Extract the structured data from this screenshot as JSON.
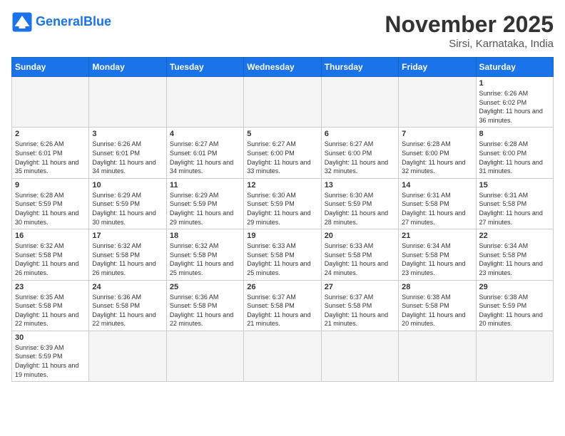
{
  "header": {
    "logo_general": "General",
    "logo_blue": "Blue",
    "month_title": "November 2025",
    "location": "Sirsi, Karnataka, India"
  },
  "days_of_week": [
    "Sunday",
    "Monday",
    "Tuesday",
    "Wednesday",
    "Thursday",
    "Friday",
    "Saturday"
  ],
  "weeks": [
    [
      {
        "day": "",
        "info": ""
      },
      {
        "day": "",
        "info": ""
      },
      {
        "day": "",
        "info": ""
      },
      {
        "day": "",
        "info": ""
      },
      {
        "day": "",
        "info": ""
      },
      {
        "day": "",
        "info": ""
      },
      {
        "day": "1",
        "info": "Sunrise: 6:26 AM\nSunset: 6:02 PM\nDaylight: 11 hours and 36 minutes."
      }
    ],
    [
      {
        "day": "2",
        "info": "Sunrise: 6:26 AM\nSunset: 6:01 PM\nDaylight: 11 hours and 35 minutes."
      },
      {
        "day": "3",
        "info": "Sunrise: 6:26 AM\nSunset: 6:01 PM\nDaylight: 11 hours and 34 minutes."
      },
      {
        "day": "4",
        "info": "Sunrise: 6:27 AM\nSunset: 6:01 PM\nDaylight: 11 hours and 34 minutes."
      },
      {
        "day": "5",
        "info": "Sunrise: 6:27 AM\nSunset: 6:00 PM\nDaylight: 11 hours and 33 minutes."
      },
      {
        "day": "6",
        "info": "Sunrise: 6:27 AM\nSunset: 6:00 PM\nDaylight: 11 hours and 32 minutes."
      },
      {
        "day": "7",
        "info": "Sunrise: 6:28 AM\nSunset: 6:00 PM\nDaylight: 11 hours and 32 minutes."
      },
      {
        "day": "8",
        "info": "Sunrise: 6:28 AM\nSunset: 6:00 PM\nDaylight: 11 hours and 31 minutes."
      }
    ],
    [
      {
        "day": "9",
        "info": "Sunrise: 6:28 AM\nSunset: 5:59 PM\nDaylight: 11 hours and 30 minutes."
      },
      {
        "day": "10",
        "info": "Sunrise: 6:29 AM\nSunset: 5:59 PM\nDaylight: 11 hours and 30 minutes."
      },
      {
        "day": "11",
        "info": "Sunrise: 6:29 AM\nSunset: 5:59 PM\nDaylight: 11 hours and 29 minutes."
      },
      {
        "day": "12",
        "info": "Sunrise: 6:30 AM\nSunset: 5:59 PM\nDaylight: 11 hours and 29 minutes."
      },
      {
        "day": "13",
        "info": "Sunrise: 6:30 AM\nSunset: 5:59 PM\nDaylight: 11 hours and 28 minutes."
      },
      {
        "day": "14",
        "info": "Sunrise: 6:31 AM\nSunset: 5:58 PM\nDaylight: 11 hours and 27 minutes."
      },
      {
        "day": "15",
        "info": "Sunrise: 6:31 AM\nSunset: 5:58 PM\nDaylight: 11 hours and 27 minutes."
      }
    ],
    [
      {
        "day": "16",
        "info": "Sunrise: 6:32 AM\nSunset: 5:58 PM\nDaylight: 11 hours and 26 minutes."
      },
      {
        "day": "17",
        "info": "Sunrise: 6:32 AM\nSunset: 5:58 PM\nDaylight: 11 hours and 26 minutes."
      },
      {
        "day": "18",
        "info": "Sunrise: 6:32 AM\nSunset: 5:58 PM\nDaylight: 11 hours and 25 minutes."
      },
      {
        "day": "19",
        "info": "Sunrise: 6:33 AM\nSunset: 5:58 PM\nDaylight: 11 hours and 25 minutes."
      },
      {
        "day": "20",
        "info": "Sunrise: 6:33 AM\nSunset: 5:58 PM\nDaylight: 11 hours and 24 minutes."
      },
      {
        "day": "21",
        "info": "Sunrise: 6:34 AM\nSunset: 5:58 PM\nDaylight: 11 hours and 23 minutes."
      },
      {
        "day": "22",
        "info": "Sunrise: 6:34 AM\nSunset: 5:58 PM\nDaylight: 11 hours and 23 minutes."
      }
    ],
    [
      {
        "day": "23",
        "info": "Sunrise: 6:35 AM\nSunset: 5:58 PM\nDaylight: 11 hours and 22 minutes."
      },
      {
        "day": "24",
        "info": "Sunrise: 6:36 AM\nSunset: 5:58 PM\nDaylight: 11 hours and 22 minutes."
      },
      {
        "day": "25",
        "info": "Sunrise: 6:36 AM\nSunset: 5:58 PM\nDaylight: 11 hours and 22 minutes."
      },
      {
        "day": "26",
        "info": "Sunrise: 6:37 AM\nSunset: 5:58 PM\nDaylight: 11 hours and 21 minutes."
      },
      {
        "day": "27",
        "info": "Sunrise: 6:37 AM\nSunset: 5:58 PM\nDaylight: 11 hours and 21 minutes."
      },
      {
        "day": "28",
        "info": "Sunrise: 6:38 AM\nSunset: 5:58 PM\nDaylight: 11 hours and 20 minutes."
      },
      {
        "day": "29",
        "info": "Sunrise: 6:38 AM\nSunset: 5:59 PM\nDaylight: 11 hours and 20 minutes."
      }
    ],
    [
      {
        "day": "30",
        "info": "Sunrise: 6:39 AM\nSunset: 5:59 PM\nDaylight: 11 hours and 19 minutes."
      },
      {
        "day": "",
        "info": ""
      },
      {
        "day": "",
        "info": ""
      },
      {
        "day": "",
        "info": ""
      },
      {
        "day": "",
        "info": ""
      },
      {
        "day": "",
        "info": ""
      },
      {
        "day": "",
        "info": ""
      }
    ]
  ]
}
